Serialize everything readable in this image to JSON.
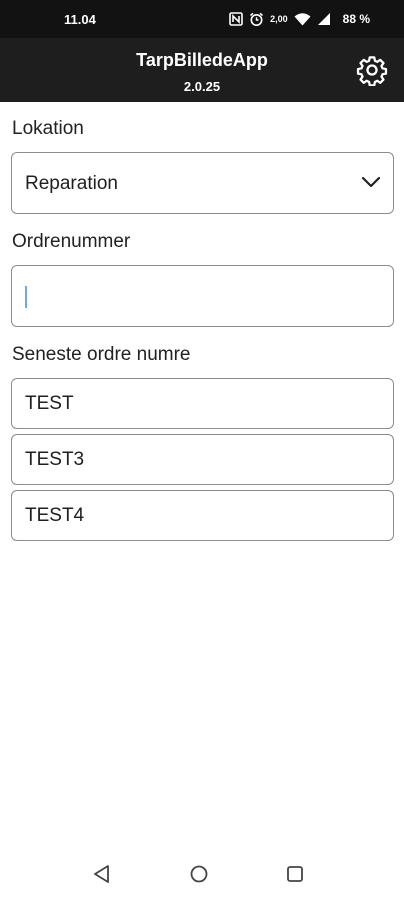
{
  "status_bar": {
    "time": "11.04",
    "alarm_time": "2,00",
    "battery": "88 %",
    "icons": [
      "nfc-icon",
      "alarm-icon",
      "data-speed-icon",
      "wifi-icon",
      "signal-icon"
    ]
  },
  "app": {
    "title": "TarpBilledeApp",
    "version": "2.0.25",
    "settings_icon": "gear-icon"
  },
  "form": {
    "location_label": "Lokation",
    "location_value": "Reparation",
    "order_label": "Ordrenummer",
    "order_value": "",
    "recent_label": "Seneste ordre numre",
    "recent_orders": [
      "TEST",
      "TEST3",
      "TEST4"
    ]
  },
  "nav": {
    "icons": [
      "back-triangle-icon",
      "home-circle-icon",
      "recents-square-icon"
    ]
  },
  "colors": {
    "app_bar": "#1e1e1e",
    "status_bar": "#121212",
    "caret": "#6aa8e8"
  }
}
